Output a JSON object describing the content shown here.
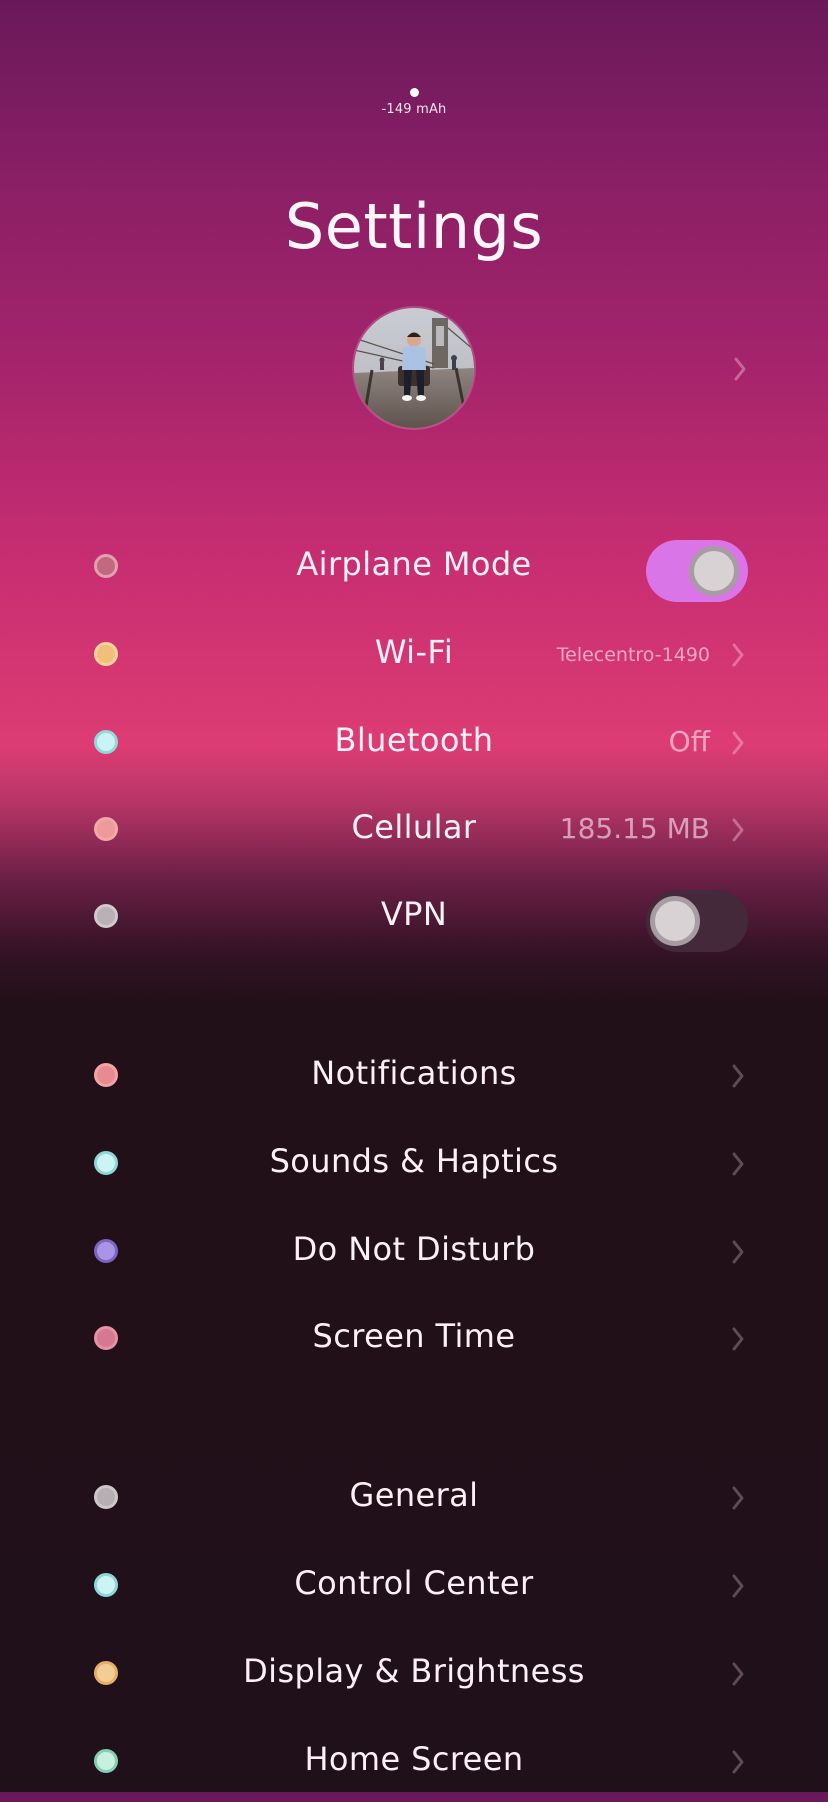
{
  "status": {
    "battery_text": "-149 mAh"
  },
  "header": {
    "title": "Settings"
  },
  "profile": {
    "avatar": "profile-photo",
    "chevron": "chevron-right-icon"
  },
  "sections": {
    "connectivity": [
      {
        "label": "Airplane Mode",
        "dot_color": "#e0a1b0",
        "control": "toggle",
        "on": true
      },
      {
        "label": "Wi-Fi",
        "dot_color": "#f4d29b",
        "value": "Telecentro-1490",
        "control": "chevron"
      },
      {
        "label": "Bluetooth",
        "dot_color": "#b7eef0",
        "value": "Off",
        "control": "chevron"
      },
      {
        "label": "Cellular",
        "dot_color": "#f3a8a7",
        "value": "185.15 MB",
        "control": "chevron"
      },
      {
        "label": "VPN",
        "dot_color": "#d1cacd",
        "control": "toggle",
        "on": false
      }
    ],
    "notifications": [
      {
        "label": "Notifications",
        "dot_color": "#f4a2a6",
        "control": "chevron"
      },
      {
        "label": "Sounds & Haptics",
        "dot_color": "#b9eff0",
        "control": "chevron"
      },
      {
        "label": "Do Not Disturb",
        "dot_color": "#a995e4",
        "control": "chevron"
      },
      {
        "label": "Screen Time",
        "dot_color": "#e492a6",
        "control": "chevron"
      }
    ],
    "general": [
      {
        "label": "General",
        "dot_color": "#cec7ca",
        "control": "chevron"
      },
      {
        "label": "Control Center",
        "dot_color": "#b9eff0",
        "control": "chevron"
      },
      {
        "label": "Display & Brightness",
        "dot_color": "#f5cf9a",
        "control": "chevron"
      },
      {
        "label": "Home Screen",
        "dot_color": "#b8ecd9",
        "control": "chevron"
      }
    ]
  },
  "colors": {
    "toggle_on": "#d975e7",
    "toggle_off": "#43293a",
    "accent_pink": "#dd3c73",
    "dark_background": "#201019"
  }
}
